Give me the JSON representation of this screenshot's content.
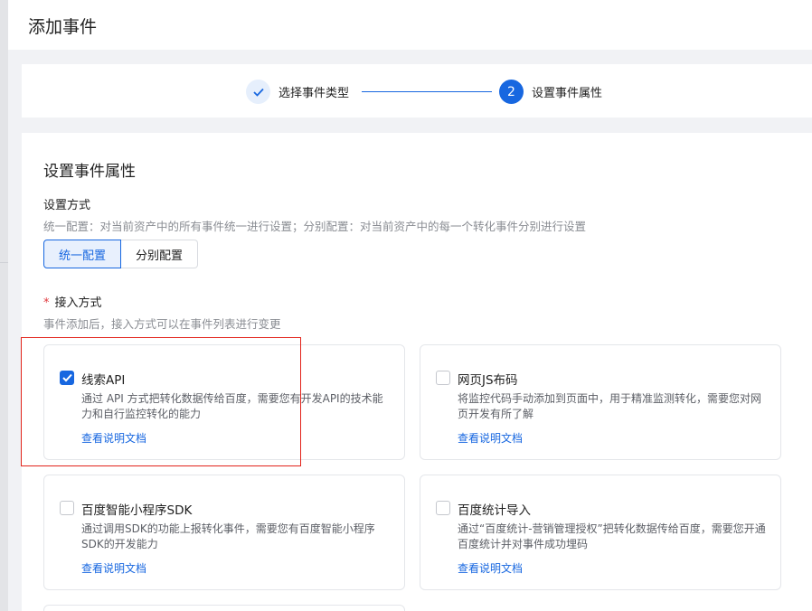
{
  "header": {
    "title": "添加事件"
  },
  "steps": [
    {
      "label": "选择事件类型",
      "status": "done",
      "icon": "check-icon"
    },
    {
      "number": "2",
      "label": "设置事件属性",
      "status": "active"
    }
  ],
  "main": {
    "section_title": "设置事件属性",
    "mode": {
      "label": "设置方式",
      "description": "统一配置：对当前资产中的所有事件统一进行设置；分别配置：对当前资产中的每一个转化事件分别进行设置",
      "options": [
        "统一配置",
        "分别配置"
      ],
      "selected": "统一配置"
    },
    "access": {
      "required_mark": "*",
      "label": "接入方式",
      "description": "事件添加后，接入方式可以在事件列表进行变更",
      "options": [
        {
          "name": "线索API",
          "checked": true,
          "description": "通过 API 方式把转化数据传给百度，需要您有开发API的技术能力和自行监控转化的能力",
          "link": "查看说明文档"
        },
        {
          "name": "网页JS布码",
          "checked": false,
          "description": "将监控代码手动添加到页面中，用于精准监测转化，需要您对网页开发有所了解",
          "link": "查看说明文档"
        },
        {
          "name": "百度智能小程序SDK",
          "checked": false,
          "description": "通过调用SDK的功能上报转化事件，需要您有百度智能小程序SDK的开发能力",
          "link": "查看说明文档"
        },
        {
          "name": "百度统计导入",
          "checked": false,
          "description": "通过“百度统计-营销管理授权”把转化数据传给百度，需要您开通百度统计并对事件成功埋码",
          "link": "查看说明文档"
        }
      ]
    }
  },
  "colors": {
    "accent": "#1767e0",
    "highlight": "#e2231a",
    "required": "#e0393e"
  }
}
